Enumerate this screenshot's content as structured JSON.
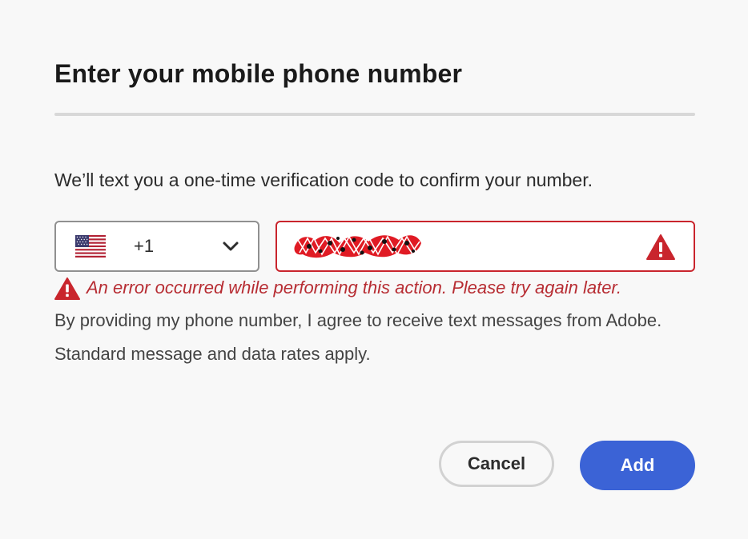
{
  "dialog": {
    "title": "Enter your mobile phone number",
    "description": "We’ll text you a one-time verification code to confirm your number.",
    "country": {
      "flag_icon": "us-flag-icon",
      "dial_code": "+1",
      "dropdown_icon": "chevron-down-icon"
    },
    "phone": {
      "value": "",
      "value_redacted": true,
      "state": "error",
      "alert_icon": "warning-icon"
    },
    "error": {
      "icon": "warning-icon",
      "message": "An error occurred while performing this action. Please try again later."
    },
    "consent": "By providing my phone number, I agree to receive text messages from Adobe. Standard message and data rates apply.",
    "buttons": {
      "cancel_label": "Cancel",
      "add_label": "Add"
    }
  },
  "colors": {
    "background": "#f8f8f8",
    "error": "#c9252d",
    "primary": "#3b63d6",
    "text": "#2c2c2c"
  }
}
